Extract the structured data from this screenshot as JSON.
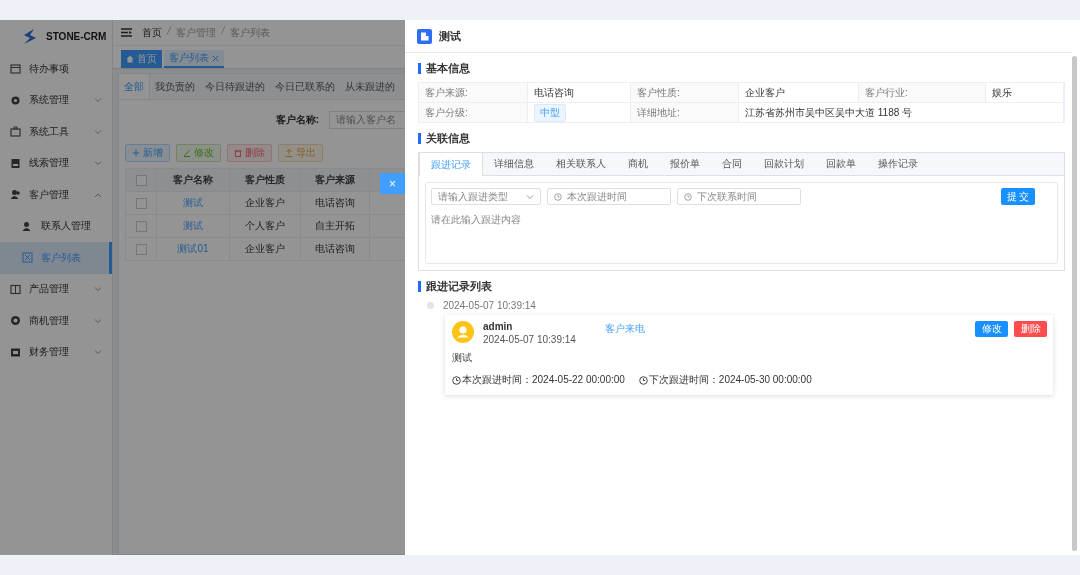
{
  "sidebar": {
    "logo": "STONE-CRM",
    "items": [
      {
        "label": "待办事项",
        "kind": "link",
        "selected": false
      },
      {
        "label": "系统管理",
        "kind": "group",
        "expanded": false,
        "selected": false
      },
      {
        "label": "系统工具",
        "kind": "group",
        "expanded": false,
        "selected": false
      },
      {
        "label": "线索管理",
        "kind": "group",
        "expanded": false,
        "selected": false
      },
      {
        "label": "客户管理",
        "kind": "group",
        "expanded": true,
        "selected": false,
        "children": [
          {
            "label": "联系人管理",
            "kind": "link",
            "selected": false
          },
          {
            "label": "客户列表",
            "kind": "link",
            "selected": true
          }
        ]
      },
      {
        "label": "产品管理",
        "kind": "group",
        "expanded": false,
        "selected": false
      },
      {
        "label": "商机管理",
        "kind": "group",
        "expanded": false,
        "selected": false
      },
      {
        "label": "财务管理",
        "kind": "group",
        "expanded": false,
        "selected": false
      }
    ]
  },
  "main": {
    "breadcrumb": [
      "首页",
      "客户管理",
      "客户列表"
    ],
    "tags": [
      {
        "label": "首页",
        "kind": "home",
        "selected": false
      },
      {
        "label": "客户列表",
        "kind": "page",
        "selected": true
      }
    ],
    "filter_tabs": [
      {
        "label": "全部",
        "selected": true
      },
      {
        "label": "我负责的",
        "selected": false
      },
      {
        "label": "今日待跟进的",
        "selected": false
      },
      {
        "label": "今日已联系的",
        "selected": false
      },
      {
        "label": "从未跟进的",
        "selected": false
      }
    ],
    "search": {
      "label": "客户名称:",
      "placeholder": "请输入客户名"
    },
    "actions": [
      {
        "label": "新增",
        "kind": "add"
      },
      {
        "label": "修改",
        "kind": "edit"
      },
      {
        "label": "删除",
        "kind": "delete"
      },
      {
        "label": "导出",
        "kind": "export"
      }
    ],
    "table": {
      "all_checked": false,
      "columns": [
        "客户名称",
        "客户性质",
        "客户来源"
      ],
      "rows": [
        {
          "checked": false,
          "cells": [
            "测试",
            "企业客户",
            "电话咨询"
          ]
        },
        {
          "checked": false,
          "cells": [
            "测试",
            "个人客户",
            "自主开拓"
          ]
        },
        {
          "checked": false,
          "cells": [
            "测试01",
            "企业客户",
            "电话咨询"
          ]
        }
      ]
    }
  },
  "drawer": {
    "close_label": "×",
    "title": "测试",
    "basic": {
      "heading": "基本信息",
      "fields": [
        {
          "label": "客户来源:",
          "value": "电话咨询",
          "kind": "text"
        },
        {
          "label": "客户性质:",
          "value": "企业客户",
          "kind": "text"
        },
        {
          "label": "客户行业:",
          "value": "娱乐",
          "kind": "text"
        },
        {
          "label": "客户分级:",
          "value": "中型",
          "kind": "tag"
        },
        {
          "label": "详细地址:",
          "value": "江苏省苏州市吴中区吴中大道 1188 号",
          "kind": "text"
        }
      ]
    },
    "related": {
      "heading": "关联信息",
      "tabs": [
        {
          "label": "跟进记录",
          "selected": true
        },
        {
          "label": "详细信息",
          "selected": false
        },
        {
          "label": "相关联系人",
          "selected": false
        },
        {
          "label": "商机",
          "selected": false
        },
        {
          "label": "报价单",
          "selected": false
        },
        {
          "label": "合同",
          "selected": false
        },
        {
          "label": "回款计划",
          "selected": false
        },
        {
          "label": "回款单",
          "selected": false
        },
        {
          "label": "操作记录",
          "selected": false
        }
      ],
      "form": {
        "type_placeholder": "请输入跟进类型",
        "this_time_placeholder": "本次跟进时间",
        "next_time_placeholder": "下次联系时间",
        "submit": "提 交",
        "content_placeholder": "请在此输入跟进内容"
      }
    },
    "records": {
      "heading": "跟进记录列表",
      "items": [
        {
          "time": "2024-05-07 10:39:14",
          "user": "admin",
          "type": "客户来电",
          "created": "2024-05-07 10:39:14",
          "content": "测试",
          "this_follow": "本次跟进时间：2024-05-22 00:00:00",
          "next_follow": "下次跟进时间：2024-05-30 00:00:00",
          "buttons": [
            {
              "label": "修改",
              "kind": "edit"
            },
            {
              "label": "删除",
              "kind": "delete"
            }
          ]
        }
      ]
    }
  }
}
